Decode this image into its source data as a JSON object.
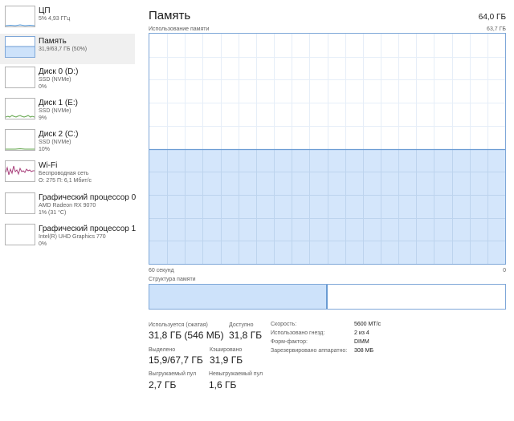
{
  "colors": {
    "memory_fill": "#cde2fa",
    "memory_border": "#7ea7d8",
    "memory_line": "#6a9bd3",
    "disk_line": "#5fa348",
    "wifi_line": "#a8407b",
    "cpu_line": "#4f94d4",
    "selected_bg": "#f0f0f0",
    "grid": "#e6eef8"
  },
  "sidebar": {
    "items": [
      {
        "title": "ЦП",
        "sub1": "5% 4,93 ГГц",
        "sub2": "",
        "icon": "cpu-thumbnail",
        "level": 0.05
      },
      {
        "title": "Память",
        "sub1": "31,9/63,7 ГБ (50%)",
        "sub2": "",
        "icon": "memory-thumbnail",
        "level": 0.5
      },
      {
        "title": "Диск 0 (D:)",
        "sub1": "SSD (NVMe)",
        "sub2": "0%",
        "icon": "disk-thumbnail",
        "level": 0
      },
      {
        "title": "Диск 1 (E:)",
        "sub1": "SSD (NVMe)",
        "sub2": "9%",
        "icon": "disk-thumbnail",
        "level": 0.09
      },
      {
        "title": "Диск 2 (C:)",
        "sub1": "SSD (NVMe)",
        "sub2": "10%",
        "icon": "disk-thumbnail",
        "level": 0.1
      },
      {
        "title": "Wi-Fi",
        "sub1": "Беспроводная сеть",
        "sub2": "О: 275 П: 6,1 Мбит/с",
        "icon": "wifi-thumbnail",
        "level": 0.3
      },
      {
        "title": "Графический процессор 0",
        "sub1": "AMD Radeon RX 9070",
        "sub2": "1% (31 °C)",
        "icon": "gpu-thumbnail",
        "level": 0.01
      },
      {
        "title": "Графический процессор 1",
        "sub1": "Intel(R) UHD Graphics 770",
        "sub2": "0%",
        "icon": "gpu-thumbnail",
        "level": 0
      }
    ]
  },
  "main": {
    "title": "Память",
    "total": "64,0 ГБ",
    "graph_label": "Использование памяти",
    "graph_max": "63,7 ГБ",
    "time_left": "60 секунд",
    "time_right": "0",
    "composition_label": "Структура памяти",
    "usage_fraction": 0.5,
    "composition_in_use_fraction": 0.5
  },
  "stats": {
    "in_use": {
      "label": "Используется (сжатая)",
      "value": "31,8 ГБ (546 МБ)"
    },
    "available": {
      "label": "Доступно",
      "value": "31,8 ГБ"
    },
    "committed": {
      "label": "Выделено",
      "value": "15,9/67,7 ГБ"
    },
    "cached": {
      "label": "Кэшировано",
      "value": "31,9 ГБ"
    },
    "paged_pool": {
      "label": "Выгружаемый пул",
      "value": "2,7 ГБ"
    },
    "nonpaged_pool": {
      "label": "Невыгружаемый пул",
      "value": "1,6 ГБ"
    }
  },
  "properties": [
    {
      "label": "Скорость:",
      "value": "5600 MT/c"
    },
    {
      "label": "Использовано гнезд:",
      "value": "2 из 4"
    },
    {
      "label": "Форм-фактор:",
      "value": "DIMM"
    },
    {
      "label": "Зарезервировано аппаратно:",
      "value": "308 МБ"
    }
  ]
}
